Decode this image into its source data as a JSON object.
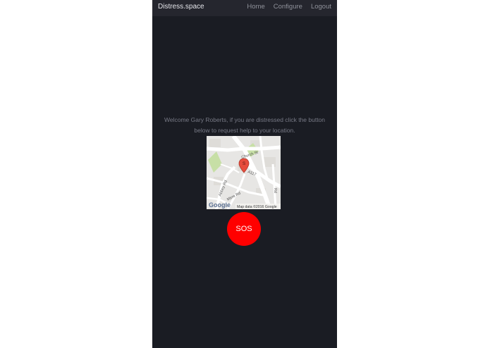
{
  "navbar": {
    "brand": "Distress.space",
    "links": [
      "Home",
      "Configure",
      "Logout"
    ]
  },
  "welcome": {
    "line1": "Welcome Gary Roberts, if you are distressed click the button",
    "line2": "below to request help to your location."
  },
  "map": {
    "streets": {
      "church": "Church St",
      "a117": "A117",
      "abbey": "Abbey Rd",
      "mirre": "Mirre Rd",
      "right": "Rd"
    },
    "marker_label": "S",
    "logo": "Google",
    "attribution": "Map data ©2016 Google"
  },
  "sos": {
    "label": "SOS"
  },
  "colors": {
    "panel": "#1a1c23",
    "navbar": "#25262e",
    "sos": "#ff0000",
    "text_muted": "#777985"
  }
}
